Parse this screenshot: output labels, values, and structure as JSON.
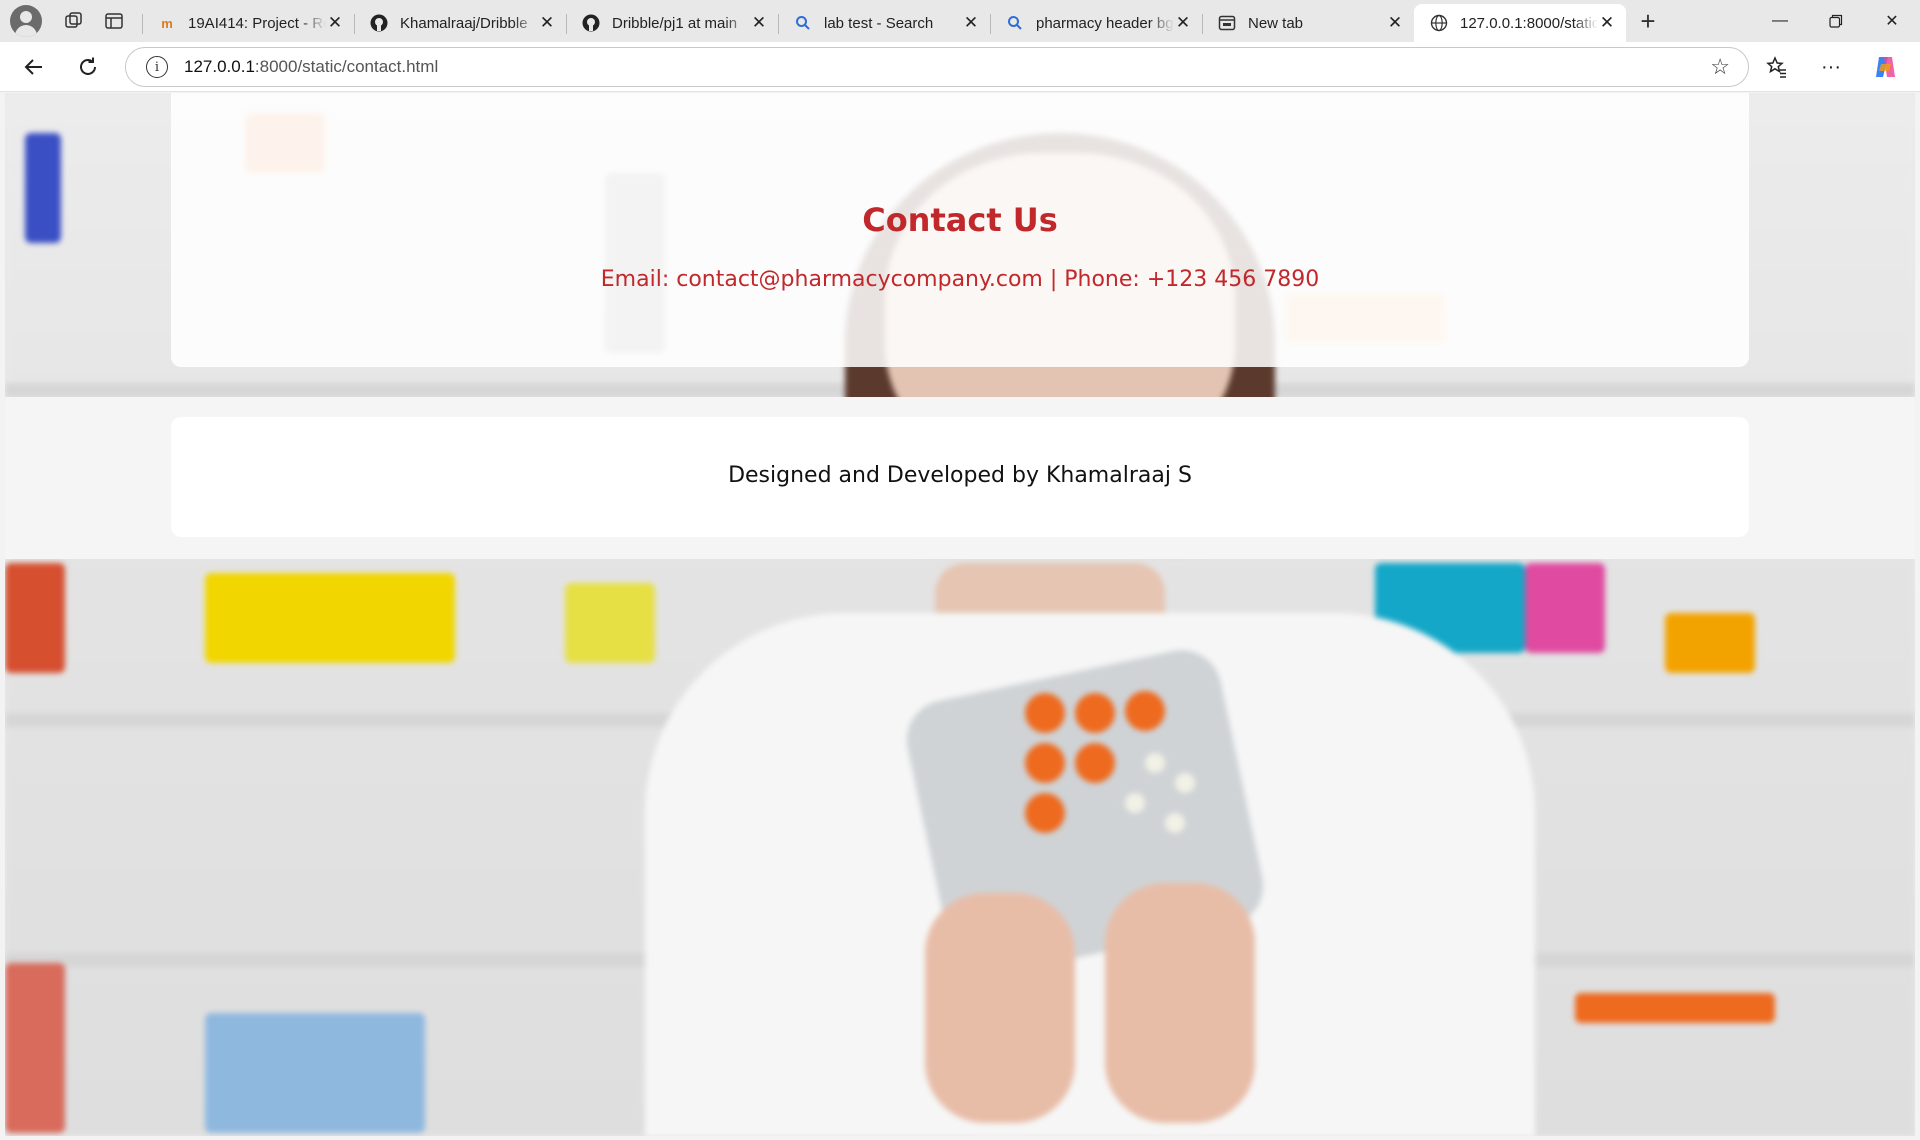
{
  "browser": {
    "tabs": [
      {
        "title": "19AI414: Project - Re",
        "favicon": "moodle-icon",
        "active": false
      },
      {
        "title": "Khamalraaj/Dribble",
        "favicon": "github-icon",
        "active": false
      },
      {
        "title": "Dribble/pj1 at main",
        "favicon": "github-icon",
        "active": false
      },
      {
        "title": "lab test - Search",
        "favicon": "search-icon",
        "active": false
      },
      {
        "title": "pharmacy header bg",
        "favicon": "search-icon",
        "active": false
      },
      {
        "title": "New tab",
        "favicon": "newtab-icon",
        "active": false
      },
      {
        "title": "127.0.0.1:8000/static",
        "favicon": "globe-icon",
        "active": true
      }
    ],
    "url": {
      "host": "127.0.0.1",
      "rest": ":8000/static/contact.html"
    }
  },
  "page": {
    "contact": {
      "title": "Contact Us",
      "info_line": "Email: contact@pharmacycompany.com | Phone: +123 456 7890"
    },
    "footer": {
      "credit": "Designed and Developed by Khamalraaj S"
    }
  },
  "colors": {
    "accent_red": "#c0282c"
  }
}
